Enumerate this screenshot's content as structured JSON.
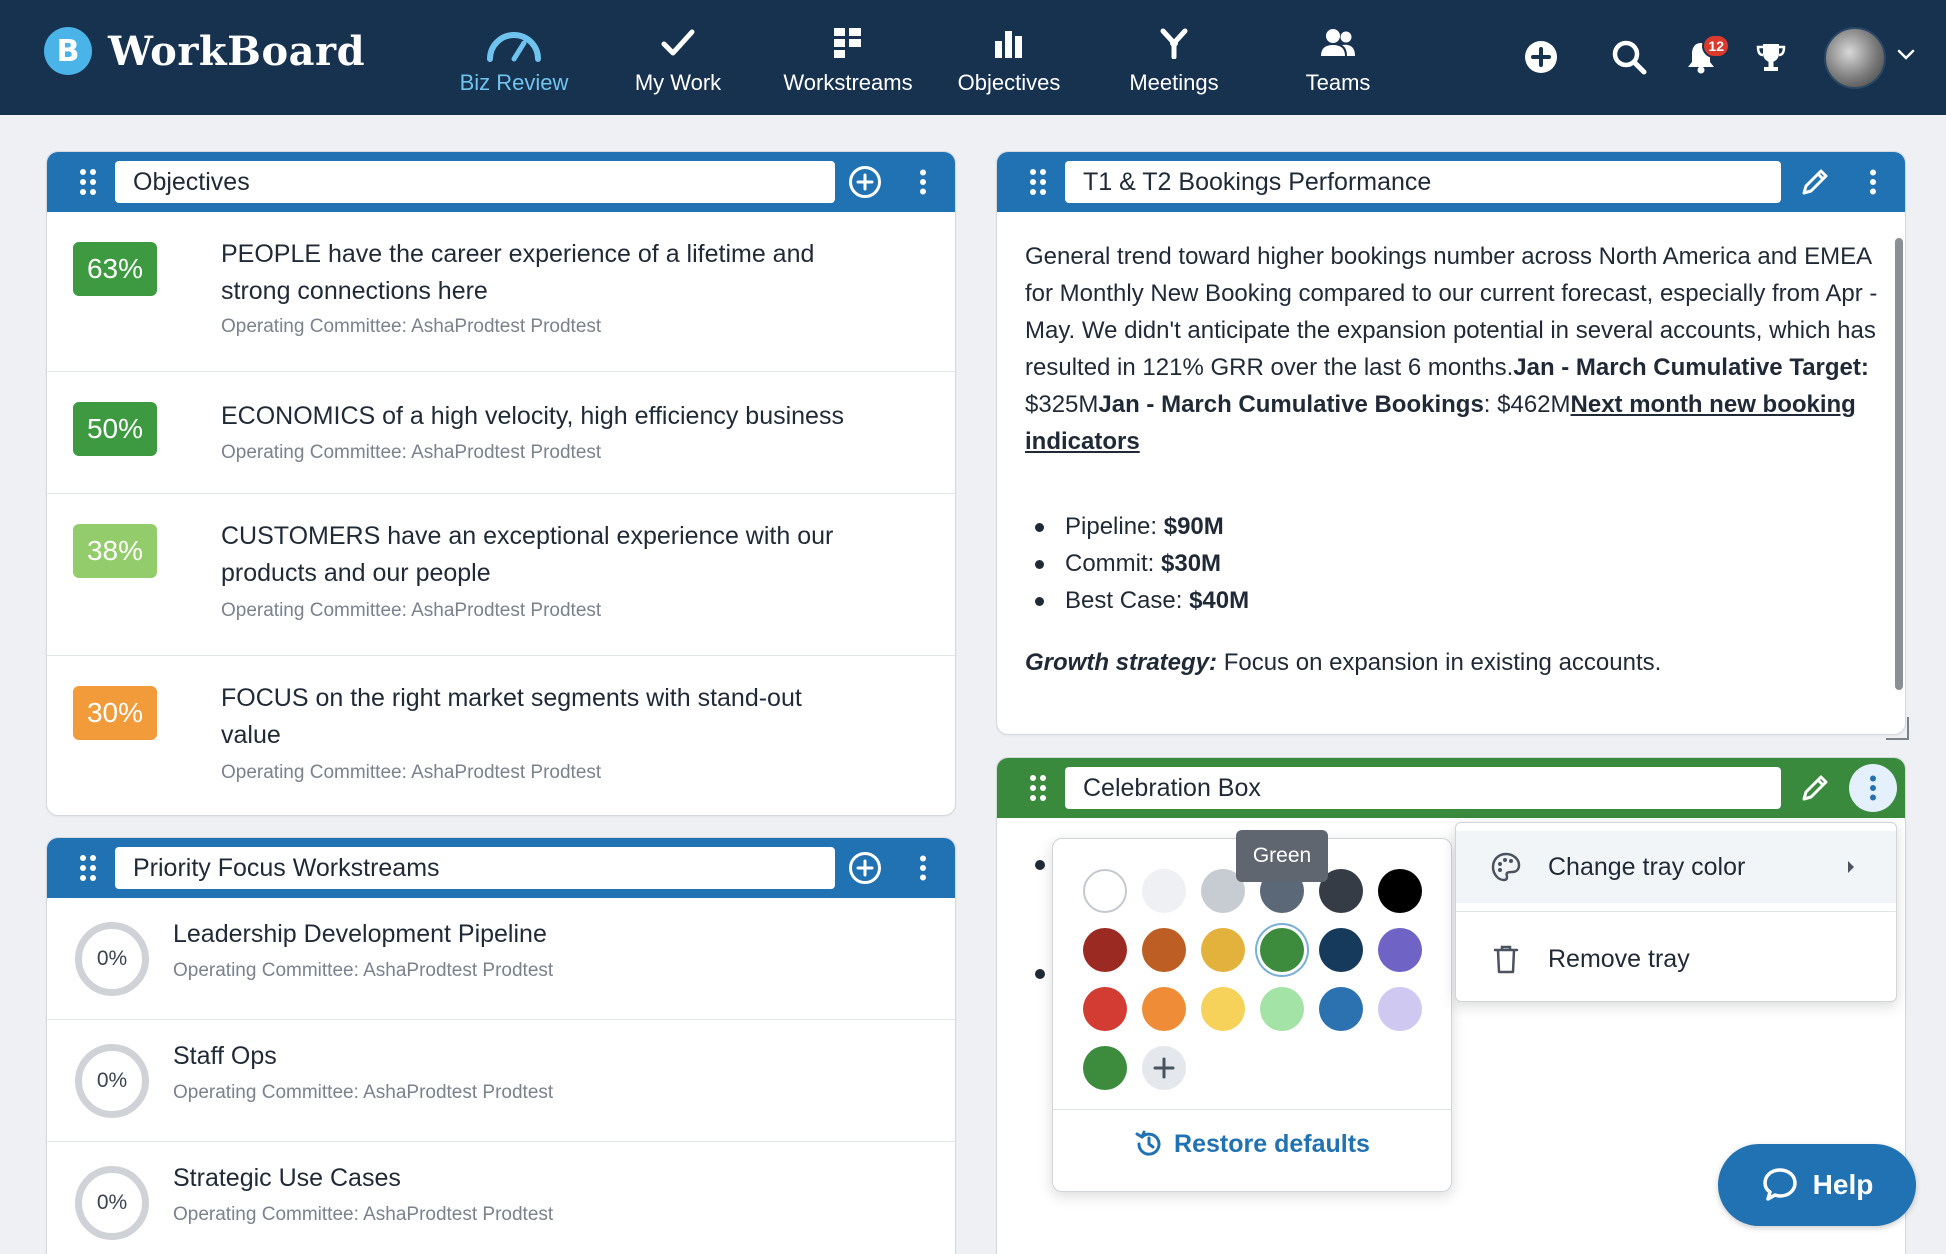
{
  "brand": {
    "name": "WorkBoard",
    "mark": "B"
  },
  "nav": {
    "items": [
      {
        "label": "Biz Review",
        "icon": "gauge-icon",
        "active": true
      },
      {
        "label": "My Work",
        "icon": "check-icon"
      },
      {
        "label": "Workstreams",
        "icon": "workstreams-icon"
      },
      {
        "label": "Objectives",
        "icon": "bar-chart-icon"
      },
      {
        "label": "Meetings",
        "icon": "meetings-icon"
      },
      {
        "label": "Teams",
        "icon": "teams-icon"
      }
    ],
    "notification_count": "12"
  },
  "objectives": {
    "title": "Objectives",
    "rows": [
      {
        "pct": "63%",
        "color": "#3d9a40",
        "title": "PEOPLE have the career experience of a lifetime and strong connections here",
        "owner": "Operating Committee: AshaProdtest Prodtest"
      },
      {
        "pct": "50%",
        "color": "#3d9a40",
        "title": "ECONOMICS of a high velocity, high efficiency business",
        "owner": "Operating Committee: AshaProdtest Prodtest"
      },
      {
        "pct": "38%",
        "color": "#93cc6b",
        "title": "CUSTOMERS have an exceptional experience with our products and our people",
        "owner": "Operating Committee: AshaProdtest Prodtest"
      },
      {
        "pct": "30%",
        "color": "#f29b3a",
        "title": "FOCUS on the right market segments with stand-out value",
        "owner": "Operating Committee: AshaProdtest Prodtest"
      }
    ]
  },
  "workstreams": {
    "title": "Priority Focus Workstreams",
    "rows": [
      {
        "pct": "0%",
        "title": "Leadership Development Pipeline",
        "owner": "Operating Committee: AshaProdtest Prodtest"
      },
      {
        "pct": "0%",
        "title": "Staff Ops",
        "owner": "Operating Committee: AshaProdtest Prodtest"
      },
      {
        "pct": "0%",
        "title": "Strategic Use Cases",
        "owner": "Operating Committee: AshaProdtest Prodtest"
      }
    ]
  },
  "bookings": {
    "title": "T1 & T2 Bookings Performance",
    "intro": "General trend toward higher bookings number across North America and EMEA for Monthly New Booking compared to our current forecast, especially from Apr - May. We didn't anticipate the expansion potential in several accounts, which has resulted in 121% GRR over the last 6 months.",
    "target_label": "Jan - March Cumulative Target:",
    "target_value": " $325M",
    "bookings_label": "Jan - March Cumulative Bookings",
    "bookings_value": ": $462M",
    "link_text": "Next month new booking indicators",
    "bullets": [
      {
        "label": "Pipeline: ",
        "value": "$90M"
      },
      {
        "label": "Commit: ",
        "value": "$30M"
      },
      {
        "label": "Best Case: ",
        "value": "$40M"
      }
    ],
    "growth_label": "Growth strategy:",
    "growth_text": " Focus on expansion in existing accounts."
  },
  "celebration": {
    "title": "Celebration Box",
    "tray_color": "#3a8a3e"
  },
  "color_picker": {
    "tooltip": "Green",
    "swatches": [
      [
        "#ffffff",
        "#eef0f3",
        "#c7ccd3",
        "#5b6877",
        "#363c45",
        "#000000"
      ],
      [
        "#9b2a22",
        "#bd5f24",
        "#e2b23c",
        "#3d8b3d",
        "#163a5c",
        "#6f63c6"
      ],
      [
        "#d33c33",
        "#ef8c37",
        "#f7d25a",
        "#a3e4a6",
        "#2d72b0",
        "#cfc8f1"
      ],
      [
        "#3d8b3d"
      ]
    ],
    "restore_label": "Restore defaults"
  },
  "tray_menu": {
    "change_color": "Change tray color",
    "remove": "Remove tray"
  },
  "help": {
    "label": "Help"
  }
}
